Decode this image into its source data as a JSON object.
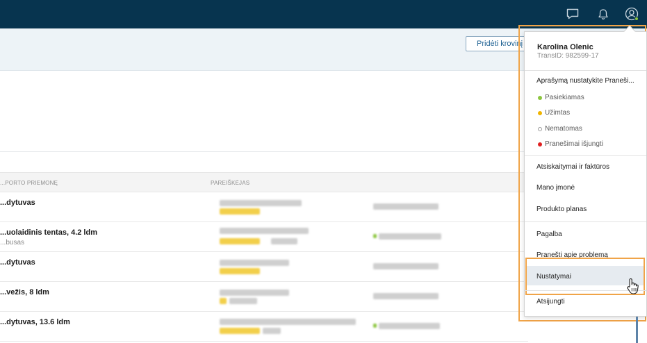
{
  "header": {
    "icons": [
      "chat-icon",
      "bell-icon",
      "user-icon"
    ],
    "background_color": "#07344f"
  },
  "toolbar": {
    "add_cargo_label": "Pridėti krovinį"
  },
  "table": {
    "columns": [
      "...PORTO PRIEMONĘ",
      "PAREIŠKĖJAS"
    ],
    "rows": [
      {
        "title": "...dytuvas",
        "subtitle": ""
      },
      {
        "title": "...uolaidinis tentas, 4.2 ldm",
        "subtitle": "...busas"
      },
      {
        "title": "...dytuvas",
        "subtitle": ""
      },
      {
        "title": "...vežis, 8 ldm",
        "subtitle": ""
      },
      {
        "title": "...dytuvas, 13.6 ldm",
        "subtitle": ""
      }
    ]
  },
  "user_menu": {
    "name": "Karolina Olenic",
    "trans_id": "TransID: 982599-17",
    "status_header": "Aprašymą nustatykite Praneši...",
    "statuses": [
      {
        "label": "Pasiekiamas",
        "color": "#8cc63f"
      },
      {
        "label": "Užimtas",
        "color": "#f0b400"
      },
      {
        "label": "Nematomas",
        "color": "#9a9a9a"
      },
      {
        "label": "Pranešimai išjungti",
        "color": "#e02020"
      }
    ],
    "items": [
      "Atsiskaitymai ir faktūros",
      "Mano įmonė",
      "Produkto planas",
      "Pagalba",
      "Pranešti apie problemą",
      "Nustatymai",
      "Atsijungti"
    ]
  },
  "colors": {
    "highlight_outline": "#f0a448",
    "accent_blue": "#1b5f91"
  }
}
